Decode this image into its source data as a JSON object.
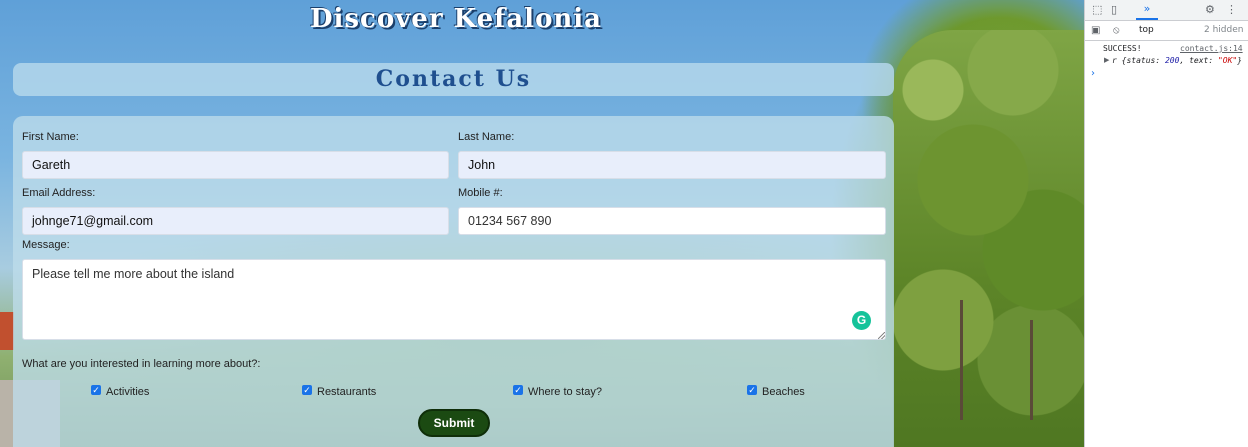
{
  "page": {
    "title": "Discover Kefalonia",
    "heading": "Contact Us"
  },
  "form": {
    "first_name": {
      "label": "First Name:",
      "value": "Gareth"
    },
    "last_name": {
      "label": "Last Name:",
      "value": "John"
    },
    "email": {
      "label": "Email Address:",
      "value": "johnge71@gmail.com"
    },
    "mobile": {
      "label": "Mobile #:",
      "value": "01234 567 890"
    },
    "message": {
      "label": "Message:",
      "value": "Please tell me more about the island"
    },
    "interests_label": "What are you interested in learning more about?:",
    "interests": [
      {
        "label": "Activities",
        "checked": true
      },
      {
        "label": "Restaurants",
        "checked": true
      },
      {
        "label": "Where to stay?",
        "checked": true
      },
      {
        "label": "Beaches",
        "checked": true
      }
    ],
    "submit_label": "Submit"
  },
  "devtools": {
    "context": "top",
    "hidden_count": "2 hidden",
    "log_message": "SUCCESS!",
    "log_source": "contact.js:14",
    "log_object_prefix": "r {status: ",
    "log_object_status": "200",
    "log_object_mid": ", text: ",
    "log_object_text": "\"OK\"",
    "log_object_suffix": "}",
    "accent_color": "#1a73e8"
  }
}
